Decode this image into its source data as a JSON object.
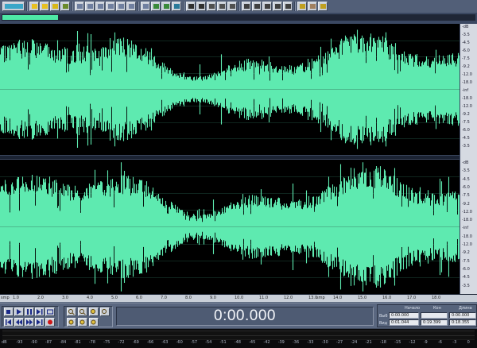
{
  "toolbar": {
    "icons": [
      "wave-view-icon",
      "new-file-icon",
      "open-file-icon",
      "save-icon",
      "reload-icon",
      "undo-icon",
      "redo-icon",
      "cut-icon",
      "copy-icon",
      "paste-icon",
      "mix-paste-icon",
      "trim-icon",
      "zoom-to-selection-icon",
      "record-settings-icon",
      "color-icon",
      "cursor-icon",
      "hand-icon",
      "grid-icon",
      "list-icon",
      "track-icon",
      "waveform-view-icon",
      "spectral-view-icon",
      "single-tone-icon",
      "noise-icon",
      "silence-icon",
      "analyze-icon",
      "fx-icon",
      "help-icon"
    ]
  },
  "wave": {
    "accent": "#5eeab0",
    "background": "#000000",
    "grid_color": "#1e4a3d"
  },
  "db_scale": {
    "channel_top": [
      "-dB",
      "-3.5",
      "-4.5",
      "-6.0",
      "-7.5",
      "-9.2",
      "-12.0",
      "-18.0",
      "-inf",
      "-18.0",
      "-12.0",
      "-9.2",
      "-7.5",
      "-6.0",
      "-4.5",
      "-3.5"
    ],
    "channel_bottom": [
      "-dB",
      "-3.5",
      "-4.5",
      "-6.0",
      "-7.5",
      "-9.2",
      "-12.0",
      "-18.0",
      "-inf",
      "-18.0",
      "-12.0",
      "-9.2",
      "-7.5",
      "-6.0",
      "-4.5",
      "-3.5"
    ]
  },
  "timeline": {
    "label_start": "smp",
    "label_end": "smp",
    "ticks": [
      "1.0",
      "2.0",
      "3.0",
      "4.0",
      "5.0",
      "6.0",
      "7.0",
      "8.0",
      "9.0",
      "10.0",
      "11.0",
      "12.0",
      "13.0",
      "14.0",
      "15.0",
      "16.0",
      "17.0",
      "18.0"
    ]
  },
  "transport": {
    "time": "0:00.000"
  },
  "selection": {
    "col_begin": "Начало",
    "col_end": "Кон",
    "col_length": "Длина",
    "row_sel": "Выб",
    "row_view": "Вид",
    "sel_begin": "0:00.000",
    "sel_end": "",
    "sel_length": "0:00.000",
    "view_begin": "0:01.044",
    "view_end": "0:19.399",
    "view_length": "0:18.355"
  },
  "levels": {
    "ticks": [
      "dB",
      "-93",
      "-90",
      "-87",
      "-84",
      "-81",
      "-78",
      "-75",
      "-72",
      "-69",
      "-66",
      "-63",
      "-60",
      "-57",
      "-54",
      "-51",
      "-48",
      "-45",
      "-42",
      "-39",
      "-36",
      "-33",
      "-30",
      "-27",
      "-24",
      "-21",
      "-18",
      "-15",
      "-12",
      "-9",
      "-6",
      "-3",
      "0"
    ]
  }
}
